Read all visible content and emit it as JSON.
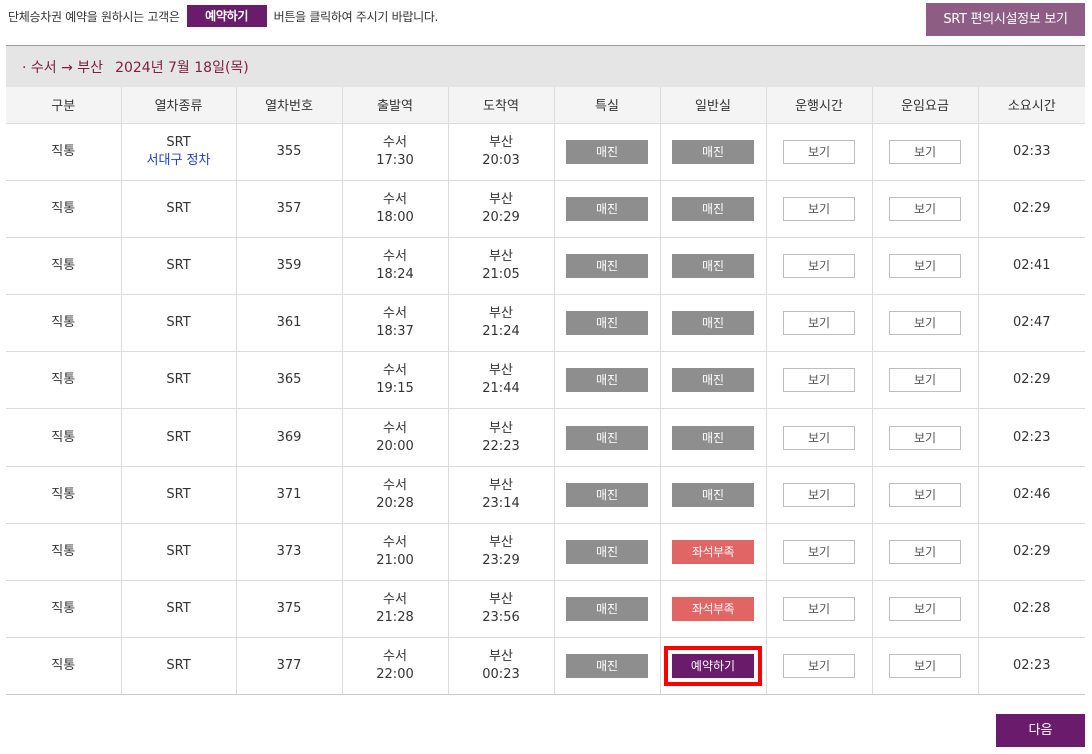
{
  "notice": {
    "before": "단체승차권 예약을 원하시는 고객은",
    "button": "예약하기",
    "after": "버튼을 클릭하여 주시기 바랍니다."
  },
  "facility_button": "SRT 편의시설정보 보기",
  "route": {
    "label": "· 수서 → 부산",
    "date": "2024년 7월 18일(목)"
  },
  "columns": [
    "구분",
    "열차종류",
    "열차번호",
    "출발역",
    "도착역",
    "특실",
    "일반실",
    "운행시간",
    "운임요금",
    "소요시간"
  ],
  "rows": [
    {
      "type": "직통",
      "train": "SRT",
      "stop_note": "서대구 정차",
      "number": "355",
      "dep_station": "수서",
      "dep_time": "17:30",
      "arr_station": "부산",
      "arr_time": "20:03",
      "special": "매진",
      "special_status": "soldout",
      "general": "매진",
      "general_status": "soldout",
      "schedule": "보기",
      "fare": "보기",
      "duration": "02:33"
    },
    {
      "type": "직통",
      "train": "SRT",
      "stop_note": "",
      "number": "357",
      "dep_station": "수서",
      "dep_time": "18:00",
      "arr_station": "부산",
      "arr_time": "20:29",
      "special": "매진",
      "special_status": "soldout",
      "general": "매진",
      "general_status": "soldout",
      "schedule": "보기",
      "fare": "보기",
      "duration": "02:29"
    },
    {
      "type": "직통",
      "train": "SRT",
      "stop_note": "",
      "number": "359",
      "dep_station": "수서",
      "dep_time": "18:24",
      "arr_station": "부산",
      "arr_time": "21:05",
      "special": "매진",
      "special_status": "soldout",
      "general": "매진",
      "general_status": "soldout",
      "schedule": "보기",
      "fare": "보기",
      "duration": "02:41"
    },
    {
      "type": "직통",
      "train": "SRT",
      "stop_note": "",
      "number": "361",
      "dep_station": "수서",
      "dep_time": "18:37",
      "arr_station": "부산",
      "arr_time": "21:24",
      "special": "매진",
      "special_status": "soldout",
      "general": "매진",
      "general_status": "soldout",
      "schedule": "보기",
      "fare": "보기",
      "duration": "02:47"
    },
    {
      "type": "직통",
      "train": "SRT",
      "stop_note": "",
      "number": "365",
      "dep_station": "수서",
      "dep_time": "19:15",
      "arr_station": "부산",
      "arr_time": "21:44",
      "special": "매진",
      "special_status": "soldout",
      "general": "매진",
      "general_status": "soldout",
      "schedule": "보기",
      "fare": "보기",
      "duration": "02:29"
    },
    {
      "type": "직통",
      "train": "SRT",
      "stop_note": "",
      "number": "369",
      "dep_station": "수서",
      "dep_time": "20:00",
      "arr_station": "부산",
      "arr_time": "22:23",
      "special": "매진",
      "special_status": "soldout",
      "general": "매진",
      "general_status": "soldout",
      "schedule": "보기",
      "fare": "보기",
      "duration": "02:23"
    },
    {
      "type": "직통",
      "train": "SRT",
      "stop_note": "",
      "number": "371",
      "dep_station": "수서",
      "dep_time": "20:28",
      "arr_station": "부산",
      "arr_time": "23:14",
      "special": "매진",
      "special_status": "soldout",
      "general": "매진",
      "general_status": "soldout",
      "schedule": "보기",
      "fare": "보기",
      "duration": "02:46"
    },
    {
      "type": "직통",
      "train": "SRT",
      "stop_note": "",
      "number": "373",
      "dep_station": "수서",
      "dep_time": "21:00",
      "arr_station": "부산",
      "arr_time": "23:29",
      "special": "매진",
      "special_status": "soldout",
      "general": "좌석부족",
      "general_status": "insufficient",
      "schedule": "보기",
      "fare": "보기",
      "duration": "02:29"
    },
    {
      "type": "직통",
      "train": "SRT",
      "stop_note": "",
      "number": "375",
      "dep_station": "수서",
      "dep_time": "21:28",
      "arr_station": "부산",
      "arr_time": "23:56",
      "special": "매진",
      "special_status": "soldout",
      "general": "좌석부족",
      "general_status": "insufficient",
      "schedule": "보기",
      "fare": "보기",
      "duration": "02:28"
    },
    {
      "type": "직통",
      "train": "SRT",
      "stop_note": "",
      "number": "377",
      "dep_station": "수서",
      "dep_time": "22:00",
      "arr_station": "부산",
      "arr_time": "00:23",
      "special": "매진",
      "special_status": "soldout",
      "general": "예약하기",
      "general_status": "available",
      "general_highlighted": true,
      "schedule": "보기",
      "fare": "보기",
      "duration": "02:23"
    }
  ],
  "next_button": "다음",
  "colors": {
    "primary_purple": "#6a1b6b",
    "facility_purple": "#8d5d86",
    "route_text": "#7d1f3f",
    "soldout_gray": "#8e8e8e",
    "insufficient_red": "#e16565",
    "highlight_red": "#ff0000",
    "stop_note_blue": "#1d3fd1"
  }
}
